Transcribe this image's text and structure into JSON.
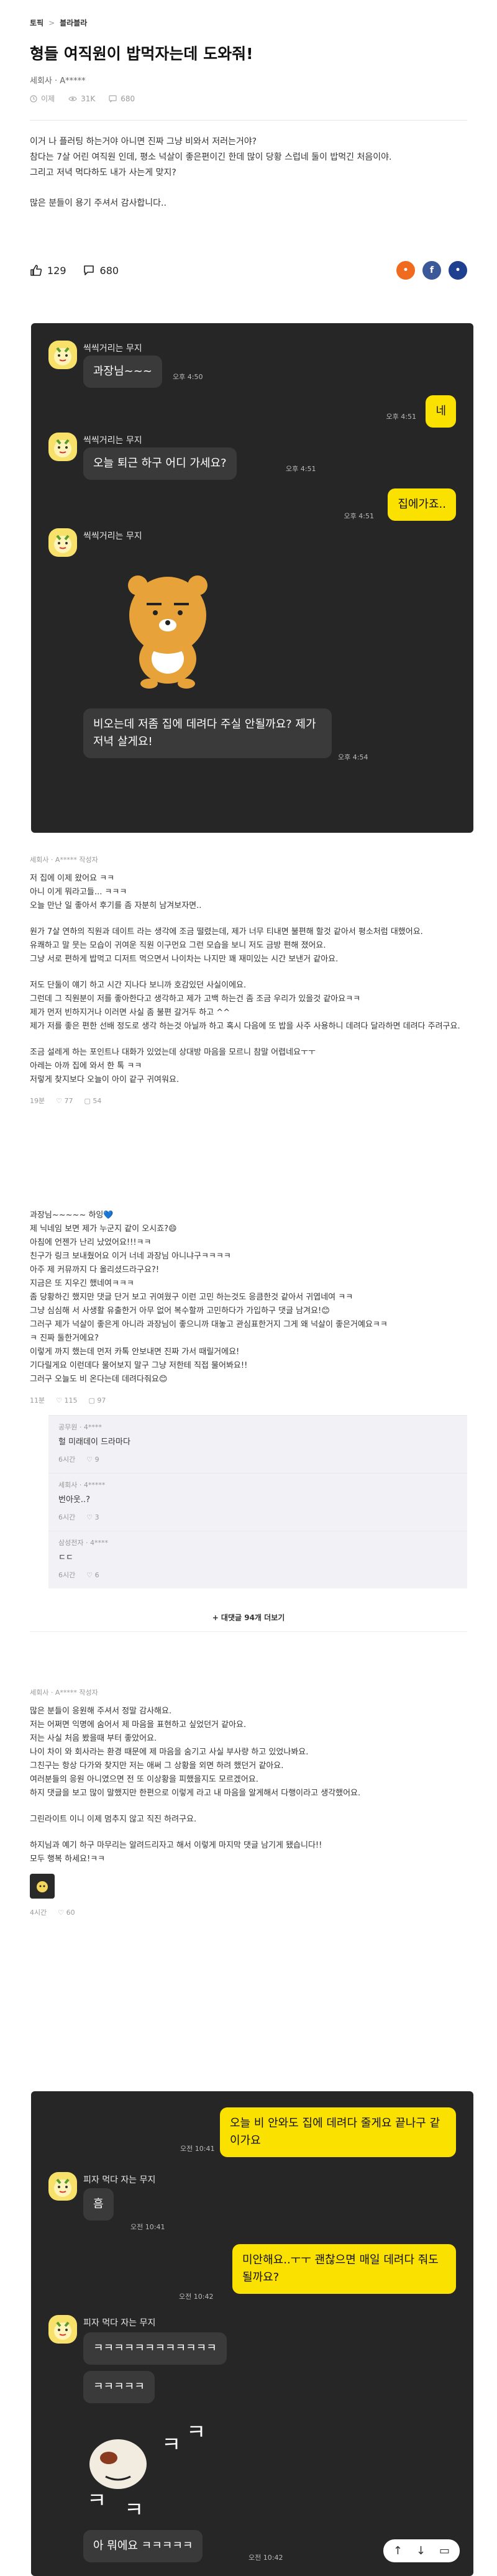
{
  "breadcrumb": {
    "home": "토픽",
    "sep": ">",
    "board": "블라블라"
  },
  "post": {
    "title": "형들 여직원이 밥먹자는데 도와줘!",
    "author": "세회사 · A*****",
    "stats": {
      "time": "이제",
      "views": "31K",
      "comments": "680"
    },
    "body": [
      "이거 나 플러팅 하는거야 아니면 진짜 그냥 비와서 저러는거야?",
      "참다는 7살 어린 여직원 인데, 평소 넉살이 좋은편이긴 한데 많이 당황 스럽네 둘이 밥먹긴 처음이야.",
      "그리고 저녁 먹다하도 내가 사는게 맞지?",
      "",
      "많은 분들이 용기 주셔서 감사합니다.."
    ],
    "likes": "129",
    "comment_count": "680"
  },
  "chat1": {
    "sender1": "씩씩거리는 무지",
    "msg1": "과장님~~~",
    "t1": "오후 4:50",
    "me1": "네",
    "t2": "오후 4:51",
    "sender2": "씩씩거리는 무지",
    "msg2": "오늘 퇴근 하구 어디 가세요?",
    "t3": "오후 4:51",
    "me2": "집에가죠..",
    "t4": "오후 4:51",
    "sender3": "씩씩거리는 무지",
    "msg3": "비오는데 저좀 집에 데려다 주실 안될까요? 제가 저녁 살게요!",
    "t5": "오후 4:54"
  },
  "comment1": {
    "meta": "세회사 · A***** 작성자",
    "lines": [
      "저 집에 이제 왔어요 ㅋㅋ",
      "아니 이게 뭐라고들... ㅋㅋㅋ",
      "오늘 만난 일 좋아서 후기를 좀 자분히 남겨보자면..",
      "",
      "원가 7살 연하의 직원과 데이트 라는 생각에 조금 떨렸는데, 제가 너무 티내면 불편해 할것 같아서 평소처럼 대했어요.",
      "유쾌하고 말 뭇는 모습이 귀여운 직원 이구먼요 그런 모습을 보니 저도 금방 편해 졌어요.",
      "그냥 서로 편하게 밥먹고 디저트 먹으면서 나이차는 나지만 꽤 재미있는 시간 보낸거 같아요.",
      "",
      "저도 단둘이 얘기 하고 시간 지나다 보니까 호감있던 사실이에요.",
      "그런데 그 직원분이 저를 좋아한다고 생각하고 제가 고백 하는건 좀 조금 우리가 있을것 같아요ㅋㅋ",
      "제가 먼저 빈하지거나 이러면 사실 좀 불편 갈거두 하고 ^^",
      "제가 저를 좋은 편한 선배 정도로 생각 하는것 아닐까 하고 혹시 다음에 또 밥을 사주 사용하니 데려다 달라하면 데려다 주려구요.",
      "",
      "조금 설레게 하는 포인트나 대화가 있었는데 상대방 마음을 모르니 참말 어렵네요ㅜㅜ",
      "아레는 아까 집에 와서 한 톡 ㅋㅋ",
      "저렇게 찾지보다 오늘이 아이 같구 귀여워요."
    ],
    "time": "19분",
    "likes": "77",
    "replies": "54"
  },
  "comment2": {
    "lines": [
      "과장님~~~~~ 하잉💙",
      "제 닉네임 보면 제가 누군지 같이 오시죠?😄",
      "아침에 언젠가 난리 났었어요!!!ㅋㅋ",
      "친구가 링크 보내줬어요 이거 너네 과장님 아니냐구ㅋㅋㅋㅋ",
      "아주 제 커뮤까지 다 올리셨드라구요?!",
      "지금은 또 지우긴 했네여ㅋㅋㅋ",
      "좀 당황하긴 했지만 댓글 단거 보고 귀여웠구 이런 고민 하는것도 응큼한것 같아서 귀엽네여 ㅋㅋ",
      "그냥 심심해 서 사생활 유출한거 아무 없어 복수할까 고민하다가 가입하구 댓글 남겨요!😊",
      "그러구 제가 넉살이 좋은게 아니라 과장님이 좋으니까 대놓고 관심표한거지 그게 왜 넉살이 좋은거예요ㅋㅋ",
      "ㅋ 진짜 둘한거에요?",
      "이렇게 까지 했는데 먼저 카톡 안보내면 진짜 가서 때릴거에요!",
      "기다릴게요 이런데다 물어보지 말구 그냥 저한테 직접 물어봐요!!",
      "그러구 오늘도 비 온다는데 데려다줘요😊"
    ],
    "time": "11분",
    "likes": "115",
    "replies": "97",
    "replies_list": [
      {
        "meta": "공무원 · 4****",
        "text": "헐 미래데이 드라마다",
        "time": "6시간",
        "likes": "9"
      },
      {
        "meta": "세회사 · 4*****",
        "text": "번아웃..?",
        "time": "6시간",
        "likes": "3"
      },
      {
        "meta": "삼성전자 · 4****",
        "text": "ㄷㄷ",
        "time": "6시간",
        "likes": "6"
      }
    ],
    "more": "+ 대댓글 94개 더보기"
  },
  "comment3": {
    "meta": "세회사 · A***** 작성자",
    "lines": [
      "많은 분들이 응원해 주셔서 정말 감사해요.",
      "저는 어쩌면 익명에 숨어서 제 마음을 표현하고 싶었던거 같아요.",
      "저는 사실 처음 봤을때 부터 좋았어요.",
      "나이 차이 와 회사라는 환경 때문에 제 마음을 숨기고 사실 부사량 하고 있었나봐요.",
      "그친구는 항상 다가와 찾지만 저는 애써 그 상황을 외면 하려 했던거 같아요.",
      "여러분들의 응원 아니였으면 전 또 이상황을 피했을지도 모르겠어요.",
      "하지 댓글을 보고 많이 말했지만 한편으로 이렇게 라고 내 마음을 알게해서 다행이라고 생각했어요.",
      "",
      "그린라이트 이니 이제 멈추지 않고 직진 하려구요.",
      "",
      "하지님과 예기 하구 마무리는 알려드리자고 해서 이렇게 마지막 댓글 남기게 됐습니다!!",
      "모두 행복 하세요!ㅋㅋ"
    ],
    "time": "4시간",
    "likes": "60"
  },
  "chat2": {
    "me1": "오늘 비 안와도 집에 데려다 줄게요 끝나구 같이가요",
    "t1": "오전 10:41",
    "sender1": "피자 먹다 자는 무지",
    "msg1": "흠",
    "t2": "오전 10:41",
    "me2": "미안해요..ㅜㅜ 괜찮으면 매일 데려다 줘도 될까요?",
    "t3": "오전 10:42",
    "sender2": "피자 먹다 자는 무지",
    "msg2": "ㅋㅋㅋㅋㅋㅋㅋㅋㅋㅋㅋㅋ",
    "msg3": "ㅋㅋㅋㅋㅋ",
    "msg4": "아 뭐에요 ㅋㅋㅋㅋㅋ",
    "t4": "오전 10:42"
  },
  "colors": {
    "kakao_yellow": "#fae100",
    "chat_bg": "#262626",
    "bubble_gray": "#3a3a3a",
    "facebook_blue": "#3b5998",
    "share_orange": "#f06a1f"
  }
}
